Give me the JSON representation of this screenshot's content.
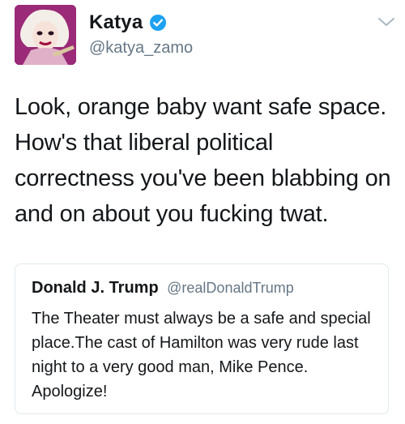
{
  "tweet": {
    "author": {
      "display_name": "Katya",
      "handle": "@katya_zamo",
      "verified": true
    },
    "text": "Look, orange baby want safe space. How's that liberal political correctness you've been blabbing on and on about you fucking twat.",
    "quoted_tweet": {
      "display_name": "Donald J. Trump",
      "handle": "@realDonaldTrump",
      "text": "The Theater must always be a safe and special place.The cast of Hamilton was very rude last night to a very good man, Mike Pence. Apologize!"
    }
  },
  "icons": {
    "verified": "verified-badge-icon",
    "menu": "chevron-down-icon"
  },
  "colors": {
    "verified_blue": "#1da1f2",
    "text_primary": "#14171a",
    "text_secondary": "#657786",
    "border": "#e1e8ed"
  }
}
